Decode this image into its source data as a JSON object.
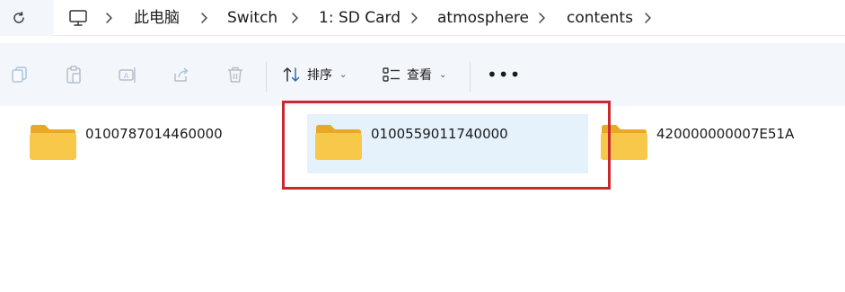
{
  "breadcrumb": {
    "items": [
      "此电脑",
      "Switch",
      "1: SD Card",
      "atmosphere",
      "contents"
    ]
  },
  "toolbar": {
    "sort_label": "排序",
    "view_label": "查看",
    "more_label": "•••"
  },
  "folders": [
    {
      "name": "0100787014460000",
      "selected": false
    },
    {
      "name": "0100559011740000",
      "selected": true
    },
    {
      "name": "420000000007E51A",
      "selected": false
    }
  ],
  "colors": {
    "accent_highlight": "#c8282e",
    "selection_bg": "#e5f1fb",
    "folder_yellow": "#f8c84a"
  }
}
